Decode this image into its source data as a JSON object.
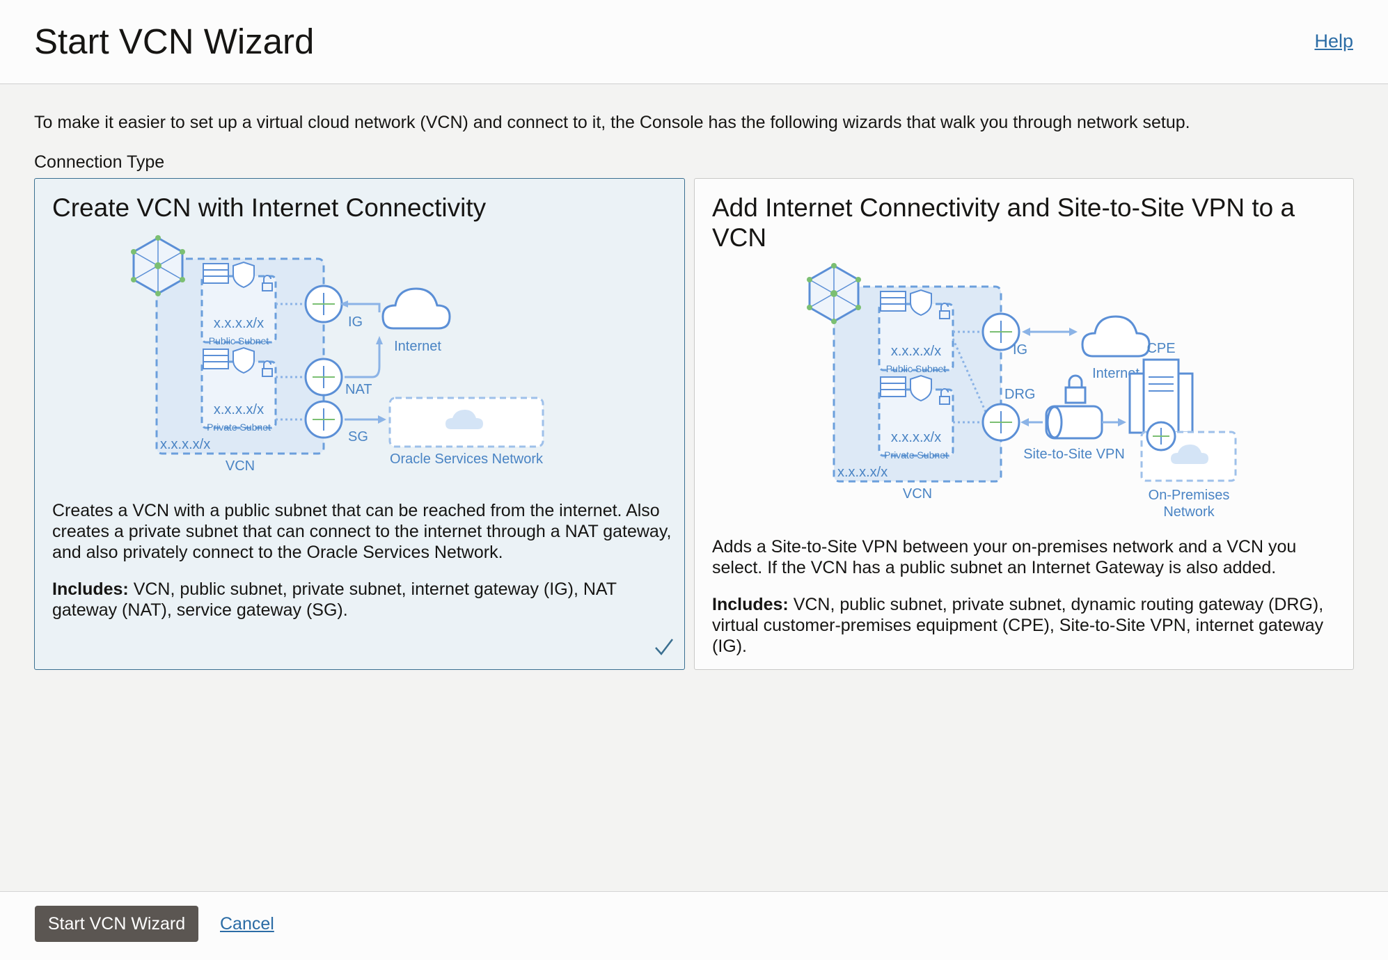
{
  "header": {
    "title": "Start VCN Wizard",
    "help_label": "Help"
  },
  "intro_text": "To make it easier to set up a virtual cloud network (VCN) and connect to it, the Console has the following wizards that walk you through network setup.",
  "connection_type_label": "Connection Type",
  "cards": [
    {
      "title": "Create VCN with Internet Connectivity",
      "selected": true,
      "description": "Creates a VCN with a public subnet that can be reached from the internet. Also creates a private subnet that can connect to the internet through a NAT gateway, and also privately connect to the Oracle Services Network.",
      "includes_label": "Includes:",
      "includes_text": "VCN, public subnet, private subnet, internet gateway (IG), NAT gateway (NAT), service gateway (SG).",
      "diagram": {
        "subnet_cidr": "x.x.x.x/x",
        "public_subnet": "Public Subnet",
        "private_subnet": "Private Subnet",
        "vcn_cidr": "x.x.x.x/x",
        "vcn": "VCN",
        "ig": "IG",
        "nat": "NAT",
        "sg": "SG",
        "internet": "Internet",
        "oracle_services": "Oracle Services Network"
      }
    },
    {
      "title": "Add Internet Connectivity and Site-to-Site VPN to a VCN",
      "selected": false,
      "description": "Adds a Site-to-Site VPN between your on-premises network and a VCN you select. If the VCN has a public subnet an Internet Gateway is also added.",
      "includes_label": "Includes:",
      "includes_text": "VCN, public subnet, private subnet, dynamic routing gateway (DRG), virtual customer-premises equipment (CPE), Site-to-Site VPN, internet gateway (IG).",
      "diagram": {
        "subnet_cidr": "x.x.x.x/x",
        "public_subnet": "Public Subnet",
        "private_subnet": "Private Subnet",
        "vcn_cidr": "x.x.x.x/x",
        "vcn": "VCN",
        "ig": "IG",
        "drg": "DRG",
        "internet": "Internet",
        "cpe": "CPE",
        "vpn": "Site-to-Site VPN",
        "on_prem_line1": "On-Premises",
        "on_prem_line2": "Network"
      }
    }
  ],
  "footer": {
    "start_button": "Start VCN Wizard",
    "cancel_label": "Cancel"
  },
  "colors": {
    "accent_link": "#2b6ca5",
    "selected_card_bg": "#ebf2f6",
    "primary_button": "#5b5652",
    "diagram_blue": "#4a84c4"
  }
}
